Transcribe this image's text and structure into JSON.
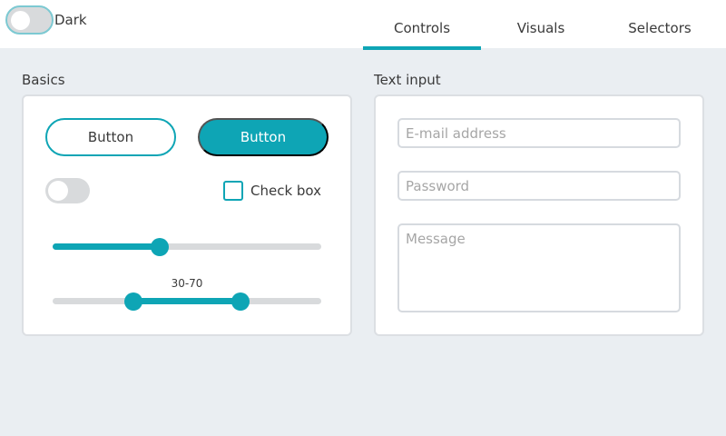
{
  "header": {
    "dark_toggle_label": "Dark",
    "tabs": [
      {
        "label": "Controls",
        "active": true
      },
      {
        "label": "Visuals",
        "active": false
      },
      {
        "label": "Selectors",
        "active": false
      }
    ]
  },
  "basics": {
    "title": "Basics",
    "button_outline_label": "Button",
    "button_filled_label": "Button",
    "checkbox_label": "Check box",
    "slider_value_percent": 40,
    "range_slider": {
      "label": "30-70",
      "low": 30,
      "high": 70
    }
  },
  "text_input": {
    "title": "Text input",
    "email_placeholder": "E-mail address",
    "password_placeholder": "Password",
    "message_placeholder": "Message"
  },
  "colors": {
    "accent": "#0ea5b5",
    "background": "#eaeef2"
  }
}
